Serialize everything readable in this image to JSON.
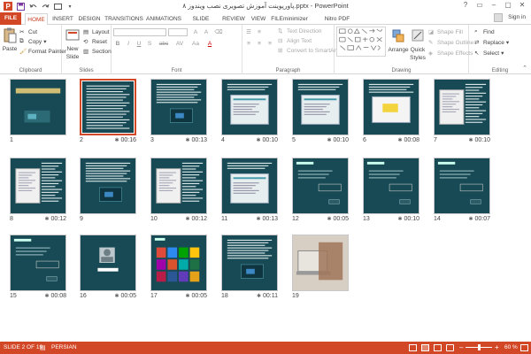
{
  "window": {
    "title": "پاورپوینت آموزش تصویری نصب ویندوز ۸.pptx - PowerPoint",
    "sign_in": "Sign in",
    "controls": [
      "?",
      "▭",
      "–",
      "▢",
      "✕"
    ]
  },
  "tabs": [
    {
      "label": "FILE",
      "type": "file"
    },
    {
      "label": "HOME",
      "type": "active"
    },
    {
      "label": "INSERT"
    },
    {
      "label": "DESIGN"
    },
    {
      "label": "TRANSITIONS"
    },
    {
      "label": "ANIMATIONS"
    },
    {
      "label": "SLIDE SHOW"
    },
    {
      "label": "REVIEW"
    },
    {
      "label": "VIEW"
    },
    {
      "label": "FILEminimizer"
    },
    {
      "label": "Nitro PDF Professional"
    }
  ],
  "ribbon": {
    "clipboard": {
      "label": "Clipboard",
      "paste": "Paste",
      "cut": "Cut",
      "copy": "Copy",
      "format_painter": "Format Painter"
    },
    "slides": {
      "label": "Slides",
      "new_slide": "New",
      "new_slide2": "Slide",
      "layout": "Layout",
      "reset": "Reset",
      "section": "Section"
    },
    "font": {
      "label": "Font",
      "bold": "B",
      "italic": "I",
      "underline": "U",
      "strike": "S",
      "abc": "abc",
      "av": "AV",
      "aa": "Aa",
      "font_color": "A"
    },
    "paragraph": {
      "label": "Paragraph",
      "text_direction": "Text Direction",
      "align_text": "Align Text",
      "convert_smartart": "Convert to SmartArt"
    },
    "drawing": {
      "label": "Drawing",
      "arrange": "Arrange",
      "quick_styles": "Quick",
      "quick_styles2": "Styles",
      "shape_fill": "Shape Fill",
      "shape_outline": "Shape Outline",
      "shape_effects": "Shape Effects"
    },
    "editing": {
      "label": "Editing",
      "find": "Find",
      "replace": "Replace",
      "select": "Select"
    }
  },
  "slides": [
    {
      "num": "1",
      "time": "",
      "kind": "title"
    },
    {
      "num": "2",
      "time": "00:16",
      "kind": "text",
      "selected": true
    },
    {
      "num": "3",
      "time": "00:13",
      "kind": "textimg"
    },
    {
      "num": "4",
      "time": "00:10",
      "kind": "dialog"
    },
    {
      "num": "5",
      "time": "00:10",
      "kind": "dialog"
    },
    {
      "num": "6",
      "time": "00:08",
      "kind": "yellow"
    },
    {
      "num": "7",
      "time": "00:10",
      "kind": "white"
    },
    {
      "num": "8",
      "time": "00:12",
      "kind": "white"
    },
    {
      "num": "9",
      "time": "",
      "kind": "textimg"
    },
    {
      "num": "10",
      "time": "00:12",
      "kind": "white"
    },
    {
      "num": "11",
      "time": "00:13",
      "kind": "dialog"
    },
    {
      "num": "12",
      "time": "00:05",
      "kind": "settings"
    },
    {
      "num": "13",
      "time": "00:10",
      "kind": "settings"
    },
    {
      "num": "14",
      "time": "00:07",
      "kind": "settings"
    },
    {
      "num": "15",
      "time": "00:08",
      "kind": "settings"
    },
    {
      "num": "16",
      "time": "00:05",
      "kind": "user"
    },
    {
      "num": "17",
      "time": "00:05",
      "kind": "tiles"
    },
    {
      "num": "18",
      "time": "00:11",
      "kind": "textimg"
    },
    {
      "num": "19",
      "time": "",
      "kind": "photo"
    }
  ],
  "statusbar": {
    "slide_info": "SLIDE 2 OF 19",
    "language": "PERSIAN",
    "zoom": "60 %",
    "minus": "–",
    "plus": "+"
  },
  "colors": {
    "accent": "#d24726",
    "slide_bg": "#174a54"
  }
}
